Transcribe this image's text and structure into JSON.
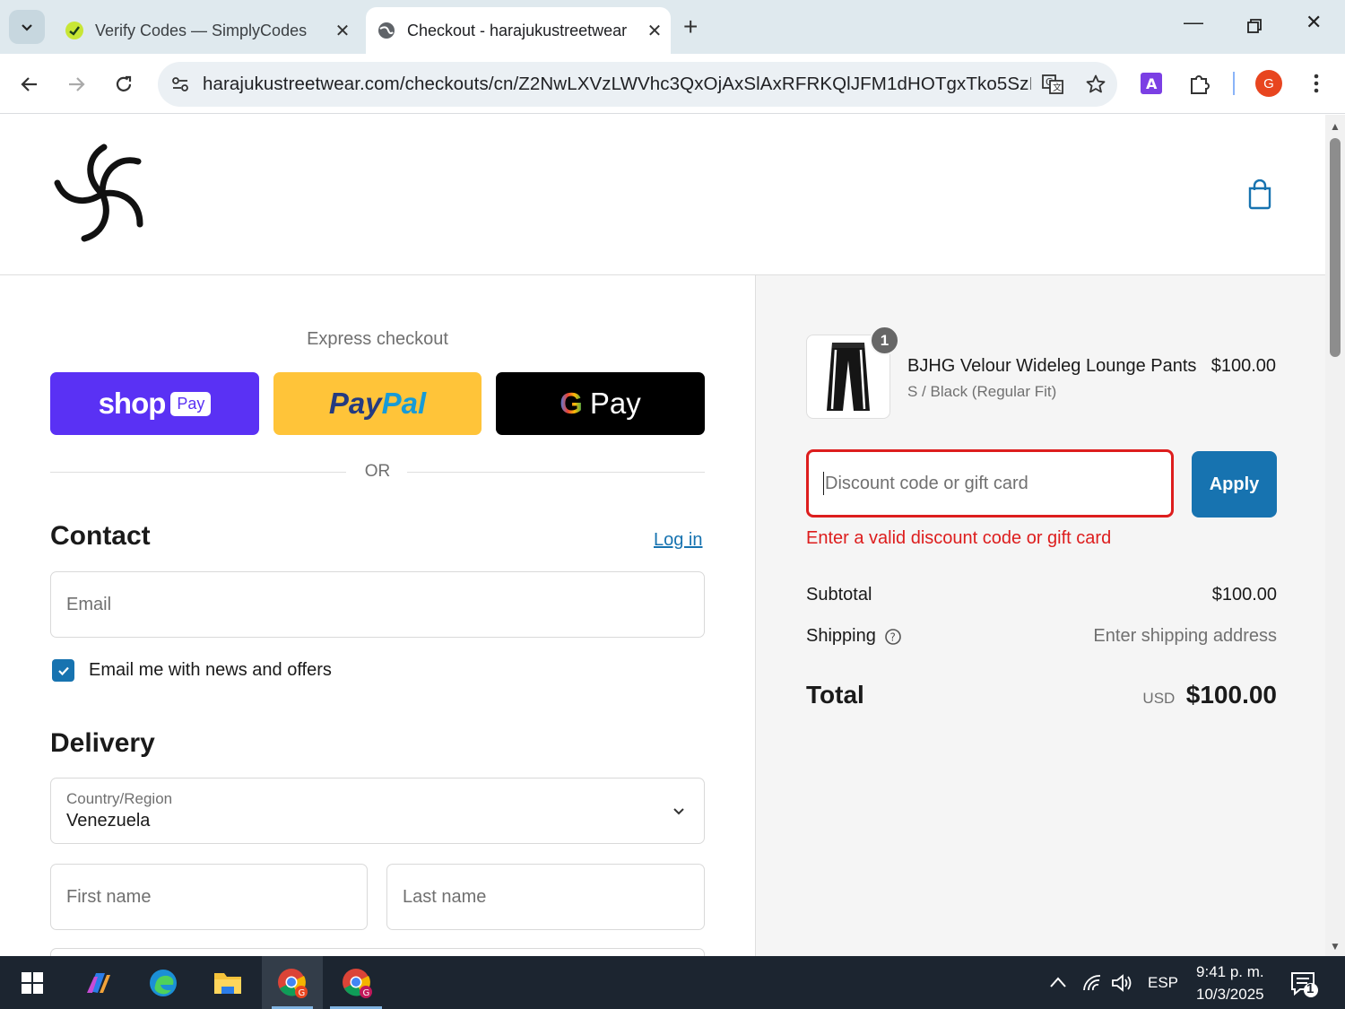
{
  "browser": {
    "tabs": [
      {
        "label": "Verify Codes — SimplyCodes",
        "active": false
      },
      {
        "label": "Checkout - harajukustreetwear",
        "active": true
      }
    ],
    "url": "harajukustreetwear.com/checkouts/cn/Z2NwLXVzLWVhc3QxOjAxSlAxRFRKQlJFM1dHOTgxTko5SzI..."
  },
  "checkout": {
    "express_title": "Express checkout",
    "shop_pay": {
      "shop": "shop",
      "pay": "Pay"
    },
    "paypal": {
      "part1": "Pay",
      "part2": "Pal"
    },
    "gpay": {
      "g": "G",
      "pay": "Pay"
    },
    "or_text": "OR",
    "contact": {
      "title": "Contact",
      "login_label": "Log in",
      "email_placeholder": "Email",
      "newsletter_label": "Email me with news and offers",
      "newsletter_checked": true
    },
    "delivery": {
      "title": "Delivery",
      "country_label": "Country/Region",
      "country_value": "Venezuela",
      "first_name_placeholder": "First name",
      "last_name_placeholder": "Last name"
    }
  },
  "summary": {
    "product": {
      "name": "BJHG Velour Wideleg Lounge Pants",
      "variant": "S / Black (Regular Fit)",
      "price": "$100.00",
      "quantity": "1"
    },
    "discount_placeholder": "Discount code or gift card",
    "apply_label": "Apply",
    "discount_error": "Enter a valid discount code or gift card",
    "subtotal_label": "Subtotal",
    "subtotal_value": "$100.00",
    "shipping_label": "Shipping",
    "shipping_value": "Enter shipping address",
    "total_label": "Total",
    "total_currency": "USD",
    "total_value": "$100.00"
  },
  "taskbar": {
    "language": "ESP",
    "time": "9:41 p. m.",
    "date": "10/3/2025",
    "notification_count": "1"
  },
  "colors": {
    "accent": "#1773b0",
    "error": "#dd1d1d",
    "shop_pay": "#5a31f4",
    "paypal": "#ffc439"
  }
}
